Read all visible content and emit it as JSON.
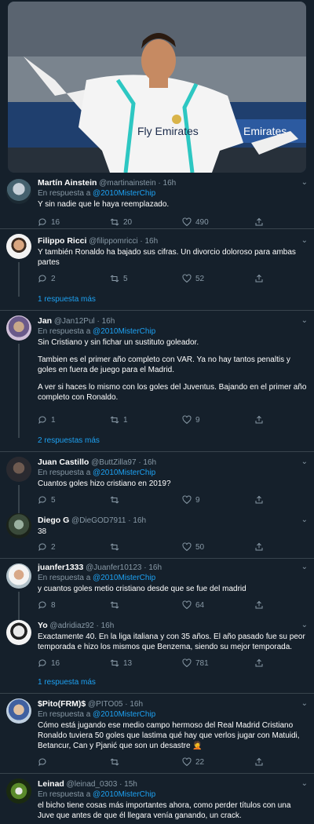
{
  "reply_prefix": "En respuesta a",
  "tweets": [
    {
      "name": "Martín Ainstein",
      "handle": "@martinainstein",
      "time": "· 16h",
      "reply_to": "@2010MisterChip",
      "text": [
        "Y sin nadie que le haya reemplazado."
      ],
      "replies": "16",
      "retweets": "20",
      "likes": "490",
      "more": ""
    },
    {
      "name": "Filippo Ricci",
      "handle": "@filippomricci",
      "time": "· 16h",
      "reply_to": "",
      "text": [
        "Y también Ronaldo ha bajado sus cifras. Un divorcio doloroso para ambas partes"
      ],
      "replies": "2",
      "retweets": "5",
      "likes": "52",
      "more": "1 respuesta más"
    },
    {
      "name": "Jan",
      "handle": "@Jan12Pul",
      "time": "· 16h",
      "reply_to": "@2010MisterChip",
      "text": [
        "Sin Cristiano y sin fichar un sustituto goleador.",
        "Tambien es el primer año completo con VAR. Ya no hay tantos penaltis y goles en fuera de juego para el Madrid.",
        "A ver si haces lo mismo con los goles del Juventus. Bajando en el primer año completo con Ronaldo."
      ],
      "replies": "1",
      "retweets": "1",
      "likes": "9",
      "more": "2 respuestas más"
    },
    {
      "name": "Juan Castillo",
      "handle": "@ButtZilla97",
      "time": "· 16h",
      "reply_to": "@2010MisterChip",
      "text": [
        "Cuantos goles hizo cristiano en 2019?"
      ],
      "replies": "5",
      "retweets": "",
      "likes": "9",
      "more": ""
    },
    {
      "name": "Diego G",
      "handle": "@DieGOD7911",
      "time": "· 16h",
      "reply_to": "",
      "text": [
        "38"
      ],
      "replies": "2",
      "retweets": "",
      "likes": "50",
      "more": ""
    },
    {
      "name": "juanfer1333",
      "handle": "@Juanfer10123",
      "time": "· 16h",
      "reply_to": "@2010MisterChip",
      "text": [
        "y cuantos goles metio cristiano desde que se fue del madrid"
      ],
      "replies": "8",
      "retweets": "",
      "likes": "64",
      "more": ""
    },
    {
      "name": "Yo",
      "handle": "@adridiaz92",
      "time": "· 16h",
      "reply_to": "",
      "text": [
        "Exactamente 40. En la liga italiana y con 35 años. El año pasado fue su peor temporada e hizo los mismos que Benzema, siendo su mejor temporada."
      ],
      "replies": "16",
      "retweets": "13",
      "likes": "781",
      "more": "1 respuesta más"
    },
    {
      "name": "$Pito(FRM)$",
      "handle": "@PITO05",
      "time": "· 16h",
      "reply_to": "@2010MisterChip",
      "text": [
        "Cómo está jugando ese medio campo hermoso del Real Madrid Cristiano Ronaldo tuviera 50 goles que lastima qué hay que verlos jugar con Matuidi, Betancur, Can y Pjanić que son un desastre 🤦"
      ],
      "replies": "",
      "retweets": "",
      "likes": "22",
      "more": ""
    },
    {
      "name": "Leinad",
      "handle": "@leinad_0303",
      "time": "· 15h",
      "reply_to": "@2010MisterChip",
      "text": [
        "el bicho tiene cosas más importantes ahora, como perder títulos con una Juve que antes de que él llegara venía ganando, un crack."
      ],
      "replies": "",
      "retweets": "",
      "likes": "",
      "more": ""
    }
  ],
  "photo": {
    "shirt_text": "Fly Emirates",
    "ad_text": "Emirates"
  },
  "colors": {
    "background": "#15202b",
    "link": "#1da1f2",
    "muted": "#8899a6",
    "divider": "#38444d"
  }
}
